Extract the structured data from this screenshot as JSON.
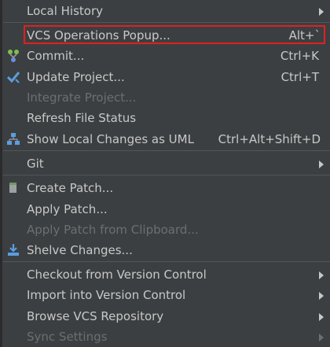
{
  "menu": {
    "local_history": {
      "label": "Local History"
    },
    "vcs_operations_popup": {
      "label": "VCS Operations Popup...",
      "shortcut": "Alt+`"
    },
    "commit": {
      "label": "Commit...",
      "shortcut": "Ctrl+K"
    },
    "update_project": {
      "label": "Update Project...",
      "shortcut": "Ctrl+T"
    },
    "integrate_project": {
      "label": "Integrate Project..."
    },
    "refresh_file_status": {
      "label": "Refresh File Status"
    },
    "show_local_changes_uml": {
      "label": "Show Local Changes as UML",
      "shortcut": "Ctrl+Alt+Shift+D"
    },
    "git": {
      "label": "Git"
    },
    "create_patch": {
      "label": "Create Patch..."
    },
    "apply_patch": {
      "label": "Apply Patch..."
    },
    "apply_patch_clipboard": {
      "label": "Apply Patch from Clipboard..."
    },
    "shelve_changes": {
      "label": "Shelve Changes..."
    },
    "checkout_vc": {
      "label": "Checkout from Version Control"
    },
    "import_vc": {
      "label": "Import into Version Control"
    },
    "browse_vcs_repo": {
      "label": "Browse VCS Repository"
    },
    "sync_settings": {
      "label": "Sync Settings"
    }
  },
  "colors": {
    "highlight_border": "#e02020",
    "menu_bg": "#3c3f41",
    "text": "#c8c8c8",
    "disabled_text": "#6c6f70"
  }
}
